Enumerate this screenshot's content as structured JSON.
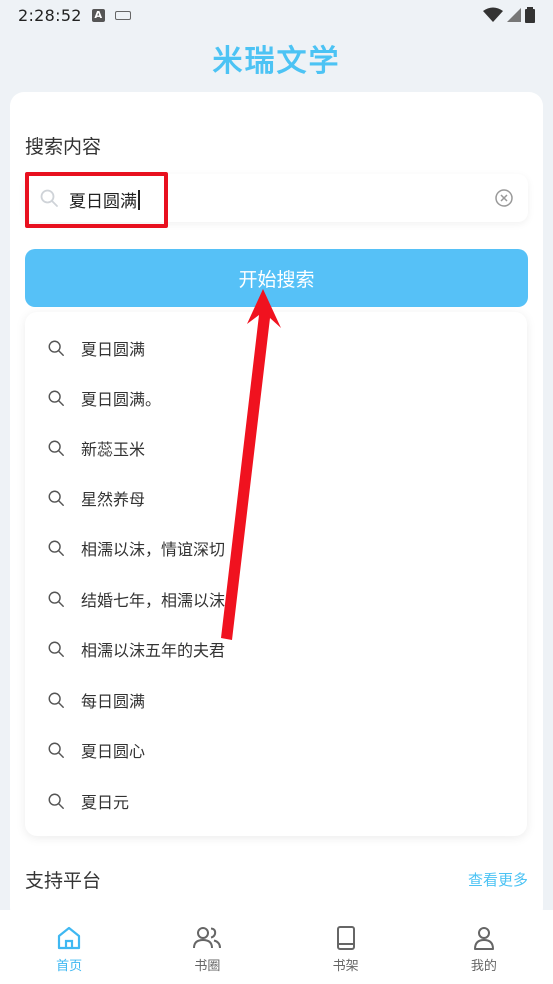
{
  "status_bar": {
    "time": "2:28:52",
    "notif_letter": "A"
  },
  "app": {
    "title": "米瑞文学"
  },
  "search": {
    "label": "搜索内容",
    "value": "夏日圆满",
    "button_label": "开始搜索"
  },
  "suggestions": [
    "夏日圆满",
    "夏日圆满。",
    "新蕊玉米",
    "星然养母",
    "相濡以沫，情谊深切",
    "结婚七年，相濡以沫",
    "相濡以沫五年的夫君",
    "每日圆满",
    "夏日圆心",
    "夏日元"
  ],
  "platforms": {
    "label": "支持平台",
    "more_label": "查看更多"
  },
  "tabs": [
    {
      "label": "首页",
      "icon": "home-icon",
      "active": true
    },
    {
      "label": "书圈",
      "icon": "users-icon",
      "active": false
    },
    {
      "label": "书架",
      "icon": "book-icon",
      "active": false
    },
    {
      "label": "我的",
      "icon": "person-icon",
      "active": false
    }
  ],
  "colors": {
    "accent": "#4cc3f4",
    "button": "#56c1f7",
    "highlight": "#e8101f"
  }
}
